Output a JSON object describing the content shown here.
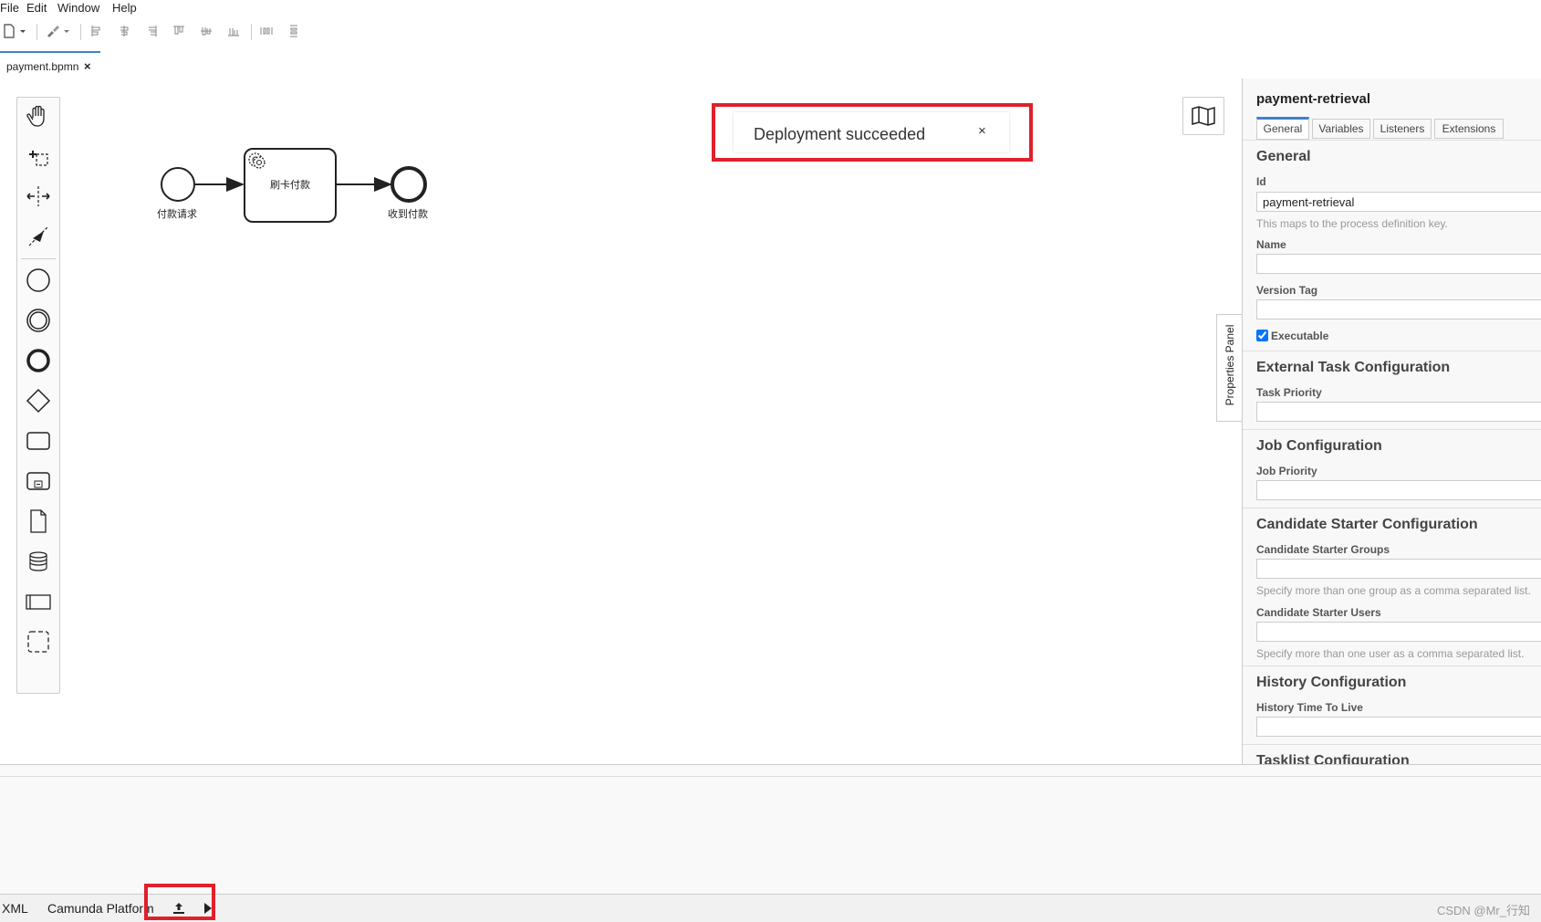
{
  "menu": {
    "file": "File",
    "edit": "Edit",
    "window": "Window",
    "help": "Help"
  },
  "tab": {
    "filename": "payment.bpmn",
    "close": "×"
  },
  "diagram": {
    "start_label": "付款请求",
    "task_label": "刷卡付款",
    "end_label": "收到付款"
  },
  "notification": {
    "text": "Deployment succeeded",
    "close": "×"
  },
  "panel_toggle": "Properties Panel",
  "properties": {
    "title": "payment-retrieval",
    "tabs": [
      "General",
      "Variables",
      "Listeners",
      "Extensions"
    ],
    "general_heading": "General",
    "id_label": "Id",
    "id_value": "payment-retrieval",
    "id_hint": "This maps to the process definition key.",
    "name_label": "Name",
    "version_tag_label": "Version Tag",
    "executable_label": "Executable",
    "external_task_heading": "External Task Configuration",
    "task_priority_label": "Task Priority",
    "job_heading": "Job Configuration",
    "job_priority_label": "Job Priority",
    "candidate_heading": "Candidate Starter Configuration",
    "candidate_groups_label": "Candidate Starter Groups",
    "candidate_groups_hint": "Specify more than one group as a comma separated list.",
    "candidate_users_label": "Candidate Starter Users",
    "candidate_users_hint": "Specify more than one user as a comma separated list.",
    "history_heading": "History Configuration",
    "history_ttl_label": "History Time To Live",
    "tasklist_heading": "Tasklist Configuration"
  },
  "statusbar": {
    "xml": "XML",
    "platform": "Camunda Platform",
    "watermark": "CSDN @Mr_行知"
  },
  "colors": {
    "accent": "#3c82ce",
    "highlight": "#e0202a"
  }
}
